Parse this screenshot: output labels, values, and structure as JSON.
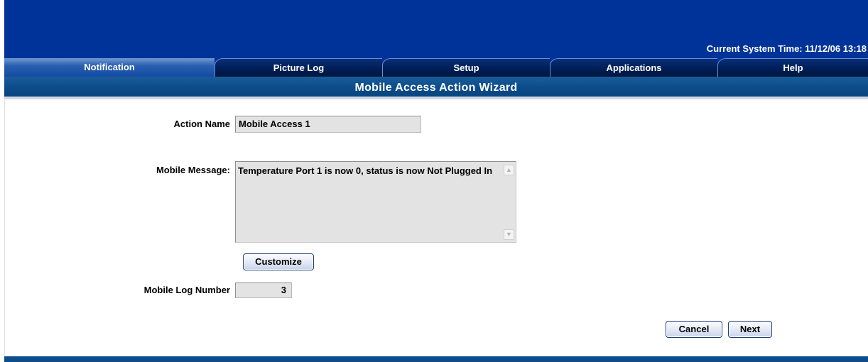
{
  "header": {
    "system_time_label": "Current System Time: 11/12/06 13:18"
  },
  "tabs": [
    {
      "label": "Notification",
      "active": true
    },
    {
      "label": "Picture Log",
      "active": false
    },
    {
      "label": "Setup",
      "active": false
    },
    {
      "label": "Applications",
      "active": false
    },
    {
      "label": "Help",
      "active": false
    }
  ],
  "page_title": "Mobile Access Action Wizard",
  "form": {
    "action_name_label": "Action Name",
    "action_name_value": "Mobile Access 1",
    "mobile_message_label": "Mobile Message:",
    "mobile_message_value": "Temperature Port 1 is now 0, status is now Not Plugged In",
    "customize_label": "Customize",
    "mobile_log_number_label": "Mobile Log Number",
    "mobile_log_number_value": "3"
  },
  "actions": {
    "cancel_label": "Cancel",
    "next_label": "Next"
  },
  "icons": {
    "scroll_up": "chevron-up-icon",
    "scroll_down": "chevron-down-icon"
  },
  "colors": {
    "banner": "#003399",
    "title_bar": "#0d4d8c",
    "active_tab": "#2b5fb0",
    "field_background": "#e3e3e3"
  }
}
